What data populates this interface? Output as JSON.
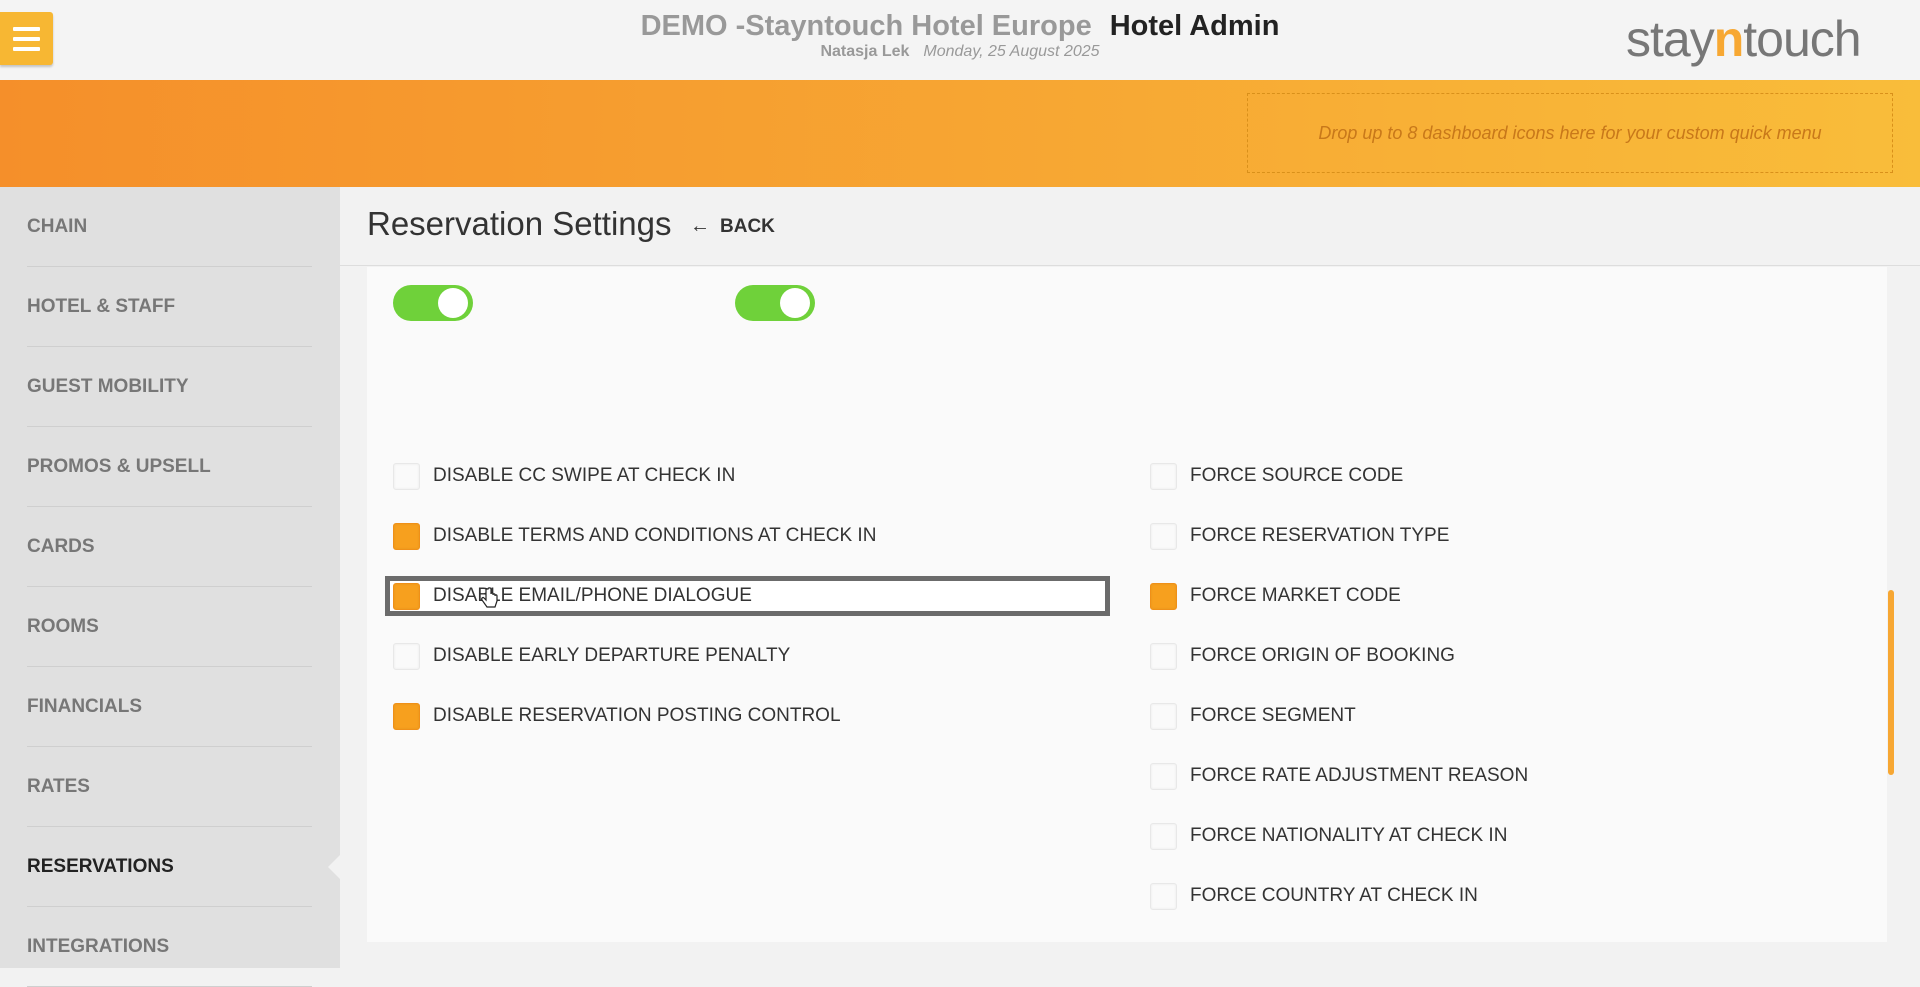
{
  "header": {
    "hotel_name": "DEMO -Stayntouch Hotel Europe",
    "app_name": "Hotel Admin",
    "user_name": "Natasja Lek",
    "date": "Monday, 25 August 2025",
    "logo_prefix": "stay",
    "logo_n": "n",
    "logo_suffix": "touch"
  },
  "banner": {
    "dropzone_text": "Drop up to 8 dashboard icons here for your custom quick menu"
  },
  "sidebar": {
    "items": [
      {
        "label": "CHAIN"
      },
      {
        "label": "HOTEL & STAFF"
      },
      {
        "label": "GUEST MOBILITY"
      },
      {
        "label": "PROMOS & UPSELL"
      },
      {
        "label": "CARDS"
      },
      {
        "label": "ROOMS"
      },
      {
        "label": "FINANCIALS"
      },
      {
        "label": "RATES"
      },
      {
        "label": "RESERVATIONS",
        "active": true
      },
      {
        "label": "INTEGRATIONS"
      }
    ]
  },
  "main": {
    "title": "Reservation Settings",
    "back_label": "BACK",
    "toggles": [
      {
        "state": "on"
      },
      {
        "state": "on"
      }
    ],
    "left_options": [
      {
        "label": "DISABLE CC SWIPE AT CHECK IN",
        "checked": false
      },
      {
        "label": "DISABLE TERMS AND CONDITIONS AT CHECK IN",
        "checked": true
      },
      {
        "label": "DISABLE EMAIL/PHONE DIALOGUE",
        "checked": true,
        "focused": true
      },
      {
        "label": "DISABLE EARLY DEPARTURE PENALTY",
        "checked": false
      },
      {
        "label": "DISABLE RESERVATION POSTING CONTROL",
        "checked": true
      }
    ],
    "right_options": [
      {
        "label": "FORCE SOURCE CODE",
        "checked": false
      },
      {
        "label": "FORCE RESERVATION TYPE",
        "checked": false
      },
      {
        "label": "FORCE MARKET CODE",
        "checked": true
      },
      {
        "label": "FORCE ORIGIN OF BOOKING",
        "checked": false
      },
      {
        "label": "FORCE SEGMENT",
        "checked": false
      },
      {
        "label": "FORCE RATE ADJUSTMENT REASON",
        "checked": false
      },
      {
        "label": "FORCE NATIONALITY AT CHECK IN",
        "checked": false
      },
      {
        "label": "FORCE COUNTRY AT CHECK IN",
        "checked": false
      }
    ]
  },
  "colors": {
    "accent": "#f7a733",
    "toggle_on": "#6fd13a",
    "checkbox_checked": "#f7a01e"
  }
}
